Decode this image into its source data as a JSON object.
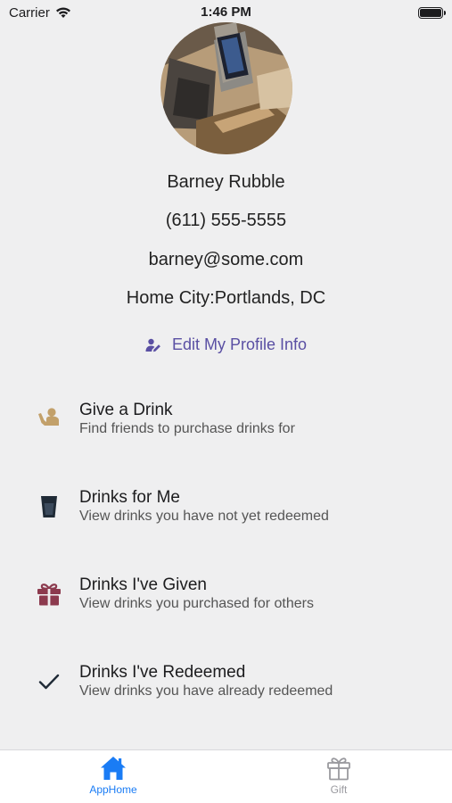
{
  "status_bar": {
    "carrier": "Carrier",
    "time": "1:46 PM"
  },
  "profile": {
    "name": "Barney Rubble",
    "phone": "(611) 555-5555",
    "email": "barney@some.com",
    "home_city": "Home City:Portlands, DC",
    "edit_label": "Edit My Profile Info"
  },
  "menu": [
    {
      "title": "Give a Drink",
      "subtitle": "Find friends to purchase drinks for",
      "icon": "hand-person-icon",
      "icon_color": "#c2a06a"
    },
    {
      "title": "Drinks for Me",
      "subtitle": "View drinks you have not yet redeemed",
      "icon": "glass-icon",
      "icon_color": "#1f2a36"
    },
    {
      "title": "Drinks I've Given",
      "subtitle": "View drinks you purchased for others",
      "icon": "gift-icon",
      "icon_color": "#8c3a4e"
    },
    {
      "title": "Drinks I've Redeemed",
      "subtitle": "View drinks you have already redeemed",
      "icon": "checkmark-icon",
      "icon_color": "#1f2a36"
    }
  ],
  "tabs": [
    {
      "label": "AppHome",
      "icon": "home-icon",
      "active": true
    },
    {
      "label": "Gift",
      "icon": "gift-icon",
      "active": false
    }
  ],
  "colors": {
    "accent": "#1a7cf5",
    "edit_link": "#5a4fa3",
    "inactive_tab": "#9a9a9f"
  }
}
